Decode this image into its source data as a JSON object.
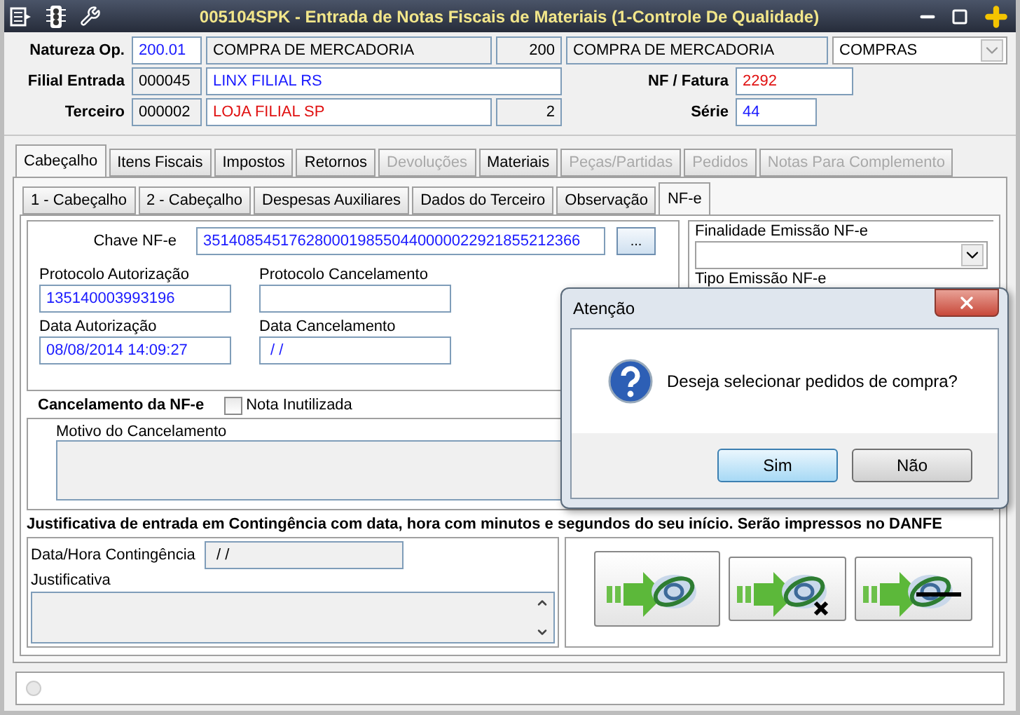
{
  "window": {
    "title": "005104SPK - Entrada de Notas Fiscais de Materiais (1-Controle De Qualidade)"
  },
  "header": {
    "natureza": {
      "label": "Natureza Op.",
      "code": "200.01",
      "description": "COMPRA DE MERCADORIA",
      "number": "200",
      "description_2": "COMPRA DE MERCADORIA",
      "type": "COMPRAS"
    },
    "filial": {
      "label": "Filial Entrada",
      "code": "000045",
      "name": "LINX FILIAL RS"
    },
    "terceiro": {
      "label": "Terceiro",
      "code": "000002",
      "name": "LOJA FILIAL SP",
      "number": "2"
    },
    "nf": {
      "label": "NF / Fatura",
      "value": "2292"
    },
    "serie": {
      "label": "Série",
      "value": "44"
    }
  },
  "tabs": [
    {
      "label": "Cabeçalho",
      "selected": true,
      "disabled": false
    },
    {
      "label": "Itens Fiscais",
      "selected": false,
      "disabled": false
    },
    {
      "label": "Impostos",
      "selected": false,
      "disabled": false
    },
    {
      "label": "Retornos",
      "selected": false,
      "disabled": false
    },
    {
      "label": "Devoluções",
      "selected": false,
      "disabled": true
    },
    {
      "label": "Materiais",
      "selected": false,
      "disabled": false
    },
    {
      "label": "Peças/Partidas",
      "selected": false,
      "disabled": true
    },
    {
      "label": "Pedidos",
      "selected": false,
      "disabled": true
    },
    {
      "label": "Notas Para Complemento",
      "selected": false,
      "disabled": true
    }
  ],
  "subtabs": [
    {
      "label": "1 - Cabeçalho",
      "selected": false
    },
    {
      "label": "2 - Cabeçalho",
      "selected": false
    },
    {
      "label": "Despesas Auxiliares",
      "selected": false
    },
    {
      "label": "Dados do Terceiro",
      "selected": false
    },
    {
      "label": "Observação",
      "selected": false
    },
    {
      "label": "NF-e",
      "selected": true
    }
  ],
  "nfe": {
    "chave_label": "Chave NF-e",
    "chave": "35140854517628000198550440000022921855212366",
    "lookup_button": "...",
    "protocolo_aut_label": "Protocolo Autorização",
    "protocolo_aut": "135140003993196",
    "protocolo_canc_label": "Protocolo Cancelamento",
    "data_aut_label": "Data Autorização",
    "data_aut": "08/08/2014 14:09:27",
    "data_canc_label": "Data Cancelamento",
    "data_canc": " / /",
    "finalidade_label": "Finalidade Emissão NF-e",
    "tipo_label": "Tipo Emissão NF-e"
  },
  "cancelamento": {
    "title": "Cancelamento da NF-e",
    "nota_inutilizada": {
      "label": "Nota Inutilizada",
      "checked": false
    },
    "motivo_label": "Motivo do Cancelamento"
  },
  "contingencia": {
    "title": "Justificativa de entrada em Contingência com data, hora com minutos e segundos do seu início. Serão impressos no DANFE",
    "data_label": "Data/Hora Contingência",
    "data": " / /",
    "justificativa_label": "Justificativa"
  },
  "dialog": {
    "title": "Atenção",
    "message": "Deseja selecionar pedidos de compra?",
    "buttons": [
      {
        "label": "Sim",
        "default": true
      },
      {
        "label": "Não",
        "default": false
      }
    ]
  }
}
